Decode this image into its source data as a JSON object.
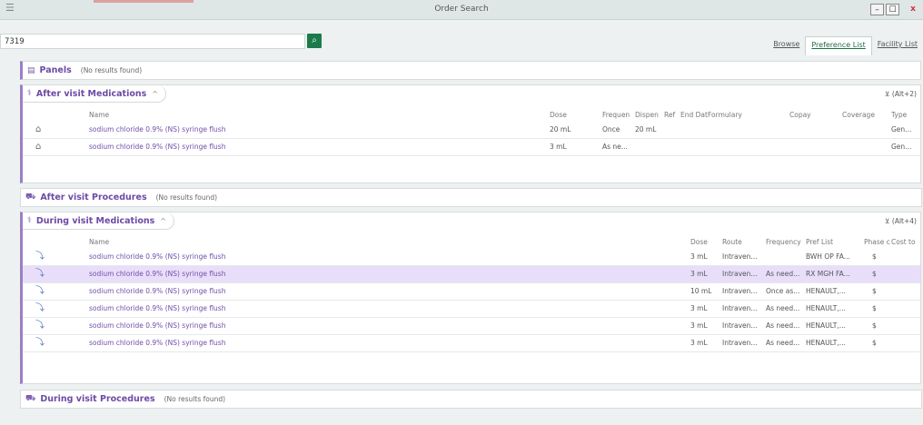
{
  "window": {
    "title": "Order Search",
    "menu_icon": "menu-icon",
    "min": "–",
    "max": "☐",
    "close": "x"
  },
  "search": {
    "value": "7319",
    "button_icon": "search-icon"
  },
  "tabs": [
    "Browse",
    "Preference List",
    "Facility List"
  ],
  "panels": {
    "title": "Panels",
    "note": "(No results found)"
  },
  "after_meds": {
    "title": "After visit Medications",
    "caret": "^",
    "shortcut": "(Alt+2)",
    "headers": {
      "name": "Name",
      "dose": "Dose",
      "freq": "Frequen",
      "disp": "Dispen",
      "ref": "Ref",
      "end": "End Dat",
      "formulary": "Formulary",
      "copay": "Copay",
      "coverage": "Coverage",
      "type": "Type"
    },
    "rows": [
      {
        "name": "sodium chloride 0.9% (NS) syringe flush",
        "dose": "20 mL",
        "freq": "Once",
        "disp": "20 mL",
        "type": "Gen..."
      },
      {
        "name": "sodium chloride 0.9% (NS) syringe flush",
        "dose": "3 mL",
        "freq": "As ne...",
        "disp": "",
        "type": "Gen..."
      }
    ]
  },
  "after_procs": {
    "title": "After visit Procedures",
    "note": "(No results found)"
  },
  "during_meds": {
    "title": "During visit Medications",
    "caret": "^",
    "shortcut": "(Alt+4)",
    "headers": {
      "name": "Name",
      "dose": "Dose",
      "route": "Route",
      "freq": "Frequency",
      "pref": "Pref List",
      "phase": "Phase c",
      "cost": "Cost to"
    },
    "rows": [
      {
        "name": "sodium chloride 0.9% (NS) syringe flush",
        "dose": "3 mL",
        "route": "Intraven...",
        "freq": "",
        "pref": "BWH OP FA...",
        "cost": "$"
      },
      {
        "name": "sodium chloride 0.9% (NS) syringe flush",
        "dose": "3 mL",
        "route": "Intraven...",
        "freq": "As need...",
        "pref": "RX MGH FA...",
        "cost": "$"
      },
      {
        "name": "sodium chloride 0.9% (NS) syringe flush",
        "dose": "10 mL",
        "route": "Intraven...",
        "freq": "Once as...",
        "pref": "HENAULT,...",
        "cost": "$"
      },
      {
        "name": "sodium chloride 0.9% (NS) syringe flush",
        "dose": "3 mL",
        "route": "Intraven...",
        "freq": "As need...",
        "pref": "HENAULT,...",
        "cost": "$"
      },
      {
        "name": "sodium chloride 0.9% (NS) syringe flush",
        "dose": "3 mL",
        "route": "Intraven...",
        "freq": "As need...",
        "pref": "HENAULT,...",
        "cost": "$"
      },
      {
        "name": "sodium chloride 0.9% (NS) syringe flush",
        "dose": "3 mL",
        "route": "Intraven...",
        "freq": "As need...",
        "pref": "HENAULT,...",
        "cost": "$"
      }
    ]
  },
  "during_procs": {
    "title": "During visit Procedures",
    "note": "(No results found)"
  },
  "icons": {
    "panels": "▤",
    "meds": "⚕",
    "procs": "⛟",
    "house": "⌂",
    "syringe": "⤵",
    "sort": "⊻"
  }
}
